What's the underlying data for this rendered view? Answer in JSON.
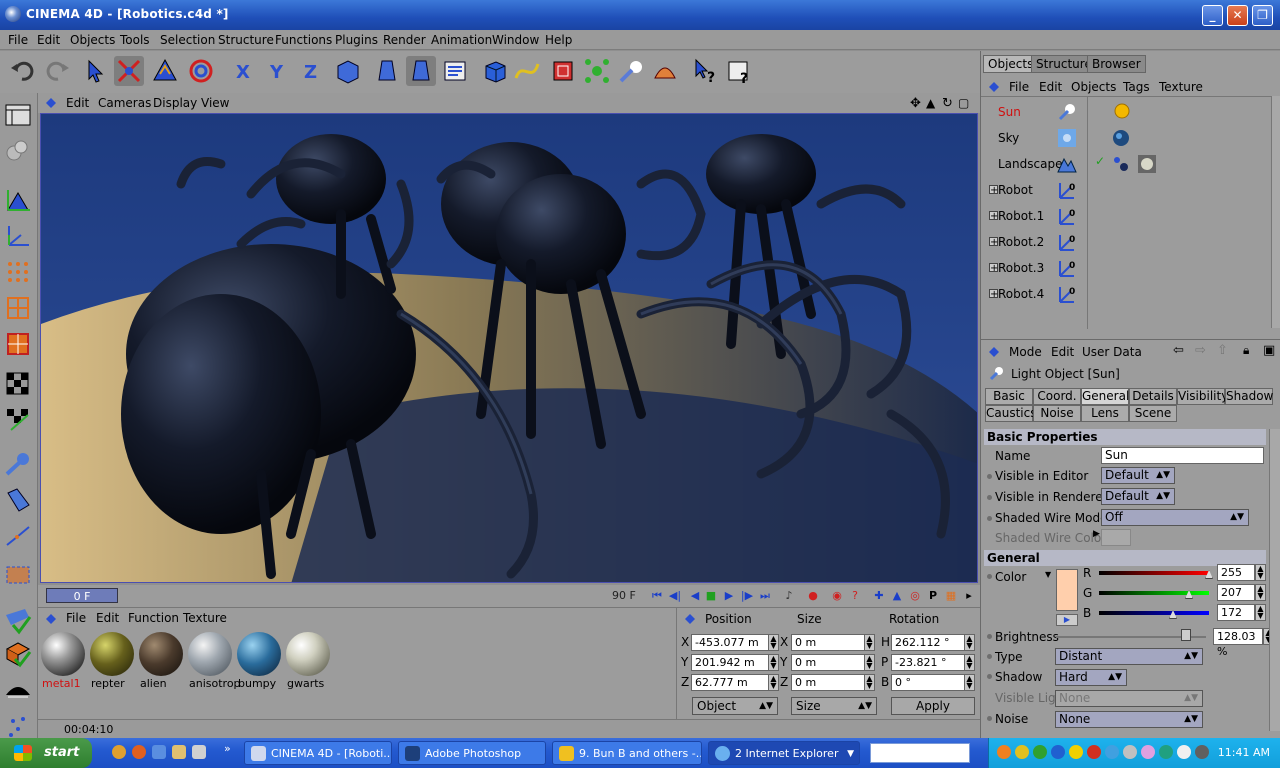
{
  "window": {
    "title": "CINEMA 4D - [Robotics.c4d *]"
  },
  "menubar": [
    "File",
    "Edit",
    "Objects",
    "Tools",
    "Selection",
    "Structure",
    "Functions",
    "Plugins",
    "Render",
    "Animation",
    "Window",
    "Help"
  ],
  "viewport": {
    "menu": [
      "Edit",
      "Cameras",
      "Display",
      "View"
    ]
  },
  "timeline": {
    "start_frame": "0 F",
    "end_frame": "90 F"
  },
  "materials": {
    "menu": [
      "File",
      "Edit",
      "Function",
      "Texture"
    ],
    "items": [
      {
        "name": "metal1",
        "selected": true
      },
      {
        "name": "repter"
      },
      {
        "name": "alien"
      },
      {
        "name": "anisotrop"
      },
      {
        "name": "bumpy"
      },
      {
        "name": "gwarts"
      }
    ]
  },
  "coordinates": {
    "headers": [
      "Position",
      "Size",
      "Rotation"
    ],
    "position": {
      "X": "-453.077 m",
      "Y": "201.942 m",
      "Z": "62.777 m"
    },
    "size": {
      "X": "0 m",
      "Y": "0 m",
      "Z": "0 m"
    },
    "rotation": {
      "H": "262.112 °",
      "P": "-23.821 °",
      "B": "0 °"
    },
    "mode_dropdown": "Object",
    "size_dropdown": "Size",
    "apply_label": "Apply"
  },
  "status": {
    "time": "00:04:10"
  },
  "object_manager": {
    "tabs": [
      "Objects",
      "Structure",
      "Browser"
    ],
    "menu": [
      "File",
      "Edit",
      "Objects",
      "Tags",
      "Texture"
    ],
    "objects": [
      {
        "name": "Sun",
        "selected": true,
        "expandable": false
      },
      {
        "name": "Sky",
        "expandable": false
      },
      {
        "name": "Landscape",
        "expandable": false
      },
      {
        "name": "Robot",
        "expandable": true
      },
      {
        "name": "Robot.1",
        "expandable": true
      },
      {
        "name": "Robot.2",
        "expandable": true
      },
      {
        "name": "Robot.3",
        "expandable": true
      },
      {
        "name": "Robot.4",
        "expandable": true
      }
    ]
  },
  "attribute_manager": {
    "menu": [
      "Mode",
      "Edit",
      "User Data"
    ],
    "object_title": "Light Object [Sun]",
    "tabs_row1": [
      "Basic",
      "Coord.",
      "General",
      "Details",
      "Visibility",
      "Shadow"
    ],
    "tabs_row2": [
      "Caustics",
      "Noise",
      "Lens",
      "Scene"
    ],
    "active_tab": "General",
    "basic_section": "Basic Properties",
    "general_section": "General",
    "name_label": "Name",
    "name_value": "Sun",
    "visible_editor_label": "Visible in Editor",
    "visible_editor_value": "Default",
    "visible_renderer_label": "Visible in Renderer",
    "visible_renderer_value": "Default",
    "shaded_wire_mode_label": "Shaded Wire Mode",
    "shaded_wire_mode_value": "Off",
    "shaded_wire_color_label": "Shaded Wire Color",
    "color_label": "Color",
    "color_hex": "#ffcfac",
    "r_label": "R",
    "r_value": "255",
    "g_label": "G",
    "g_value": "207",
    "b_label": "B",
    "b_value": "172",
    "brightness_label": "Brightness",
    "brightness_value": "128.03 %",
    "type_label": "Type",
    "type_value": "Distant",
    "shadow_label": "Shadow",
    "shadow_value": "Hard",
    "visible_light_label": "Visible Light",
    "visible_light_value": "None",
    "noise_label": "Noise",
    "noise_value": "None"
  },
  "taskbar": {
    "start_label": "start",
    "tasks": [
      {
        "label": "CINEMA 4D - [Roboti...",
        "active": false
      },
      {
        "label": "Adobe Photoshop",
        "active": false
      },
      {
        "label": "9. Bun B and others -...",
        "active": false
      },
      {
        "label": "2 Internet Explorer",
        "active": true
      }
    ],
    "clock": "11:41 AM"
  }
}
